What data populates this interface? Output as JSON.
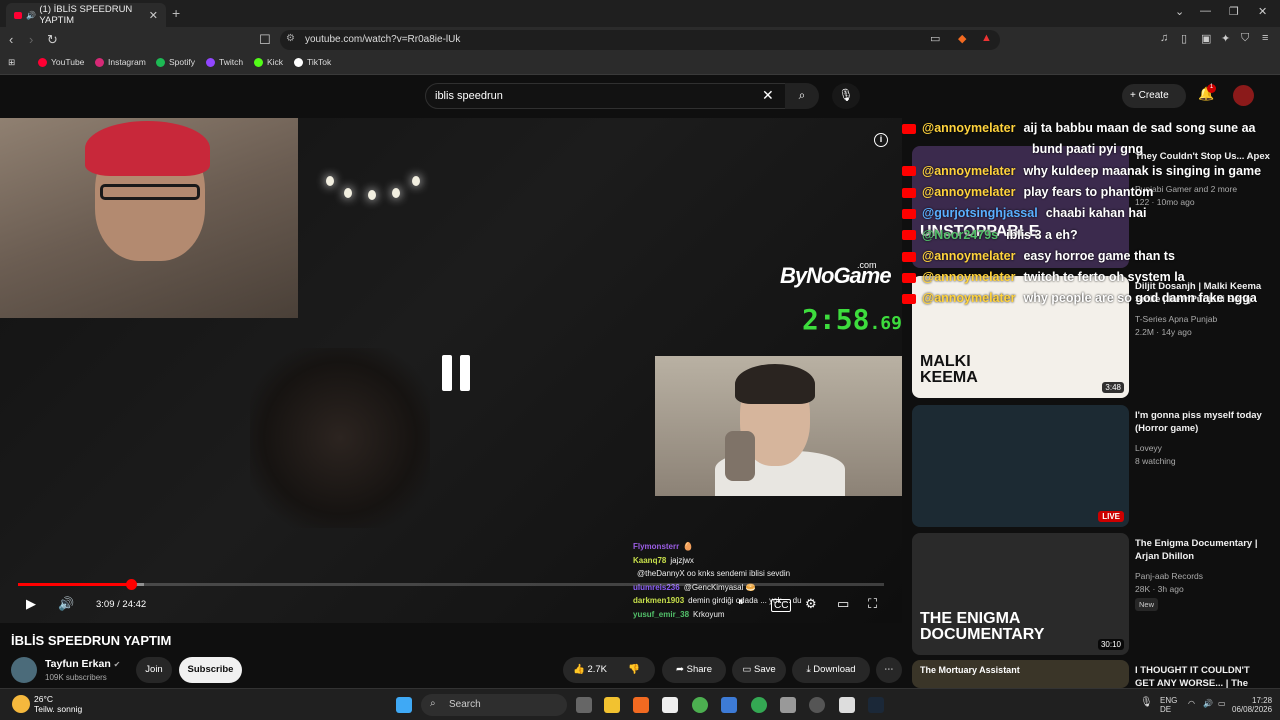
{
  "browser": {
    "tab_title": "(1) İBLİS SPEEDRUN YAPTIM",
    "url": "youtube.com/watch?v=Rr0a8ie-lUk",
    "bookmarks": [
      {
        "label": "YouTube",
        "color": "#ff0033"
      },
      {
        "label": "Instagram",
        "color": "#d62976"
      },
      {
        "label": "Spotify",
        "color": "#1db954"
      },
      {
        "label": "Twitch",
        "color": "#9146ff"
      },
      {
        "label": "Kick",
        "color": "#53fc18"
      },
      {
        "label": "TikTok",
        "color": "#ffffff"
      }
    ]
  },
  "youtube": {
    "search_value": "iblis speedrun",
    "create_label": "Create",
    "notification_count": "1"
  },
  "player": {
    "brand": "ByNoGame",
    "brand_sup": ".com",
    "timer_main": "2:58",
    "timer_ms": ".69",
    "current_time": "3:09 / 24:42",
    "progress": 0.13,
    "buffered": 0.145,
    "twitch_chat": [
      {
        "user": "Flymonsterr",
        "color": "#9b5de5",
        "msg": "🥚"
      },
      {
        "user": "Kaanq78",
        "color": "#c8e04b",
        "msg": "jajzjwx"
      },
      {
        "user": "",
        "color": "#9b5de5",
        "msg": "@theDannyX oo knks sendemi iblisi sevdin"
      },
      {
        "user": "ulumreis236",
        "color": "#8a5cf5",
        "msg": "@GencKimyasal 🥯"
      },
      {
        "user": "darkmen1903",
        "color": "#c8e04b",
        "msg": "demin girdiği odada ... yok ... du"
      },
      {
        "user": "yusuf_emir_38",
        "color": "#52c06a",
        "msg": "Krkoyum"
      }
    ]
  },
  "chat_overlay": [
    {
      "name": "@annoymelater",
      "text": "aij ta babbu maan de sad song sune aa",
      "color": "#ffd33d"
    },
    {
      "name": "",
      "text": "bund paati pyi gng",
      "color": "#ffd33d"
    },
    {
      "name": "@annoymelater",
      "text": "why kuldeep maanak is singing in game",
      "color": "#ffd33d"
    },
    {
      "name": "@annoymelater",
      "text": "play fears to phantom",
      "color": "#ffd33d"
    },
    {
      "name": "@gurjotsinghjassal",
      "text": "chaabi kahan hai",
      "color": "#5ab0ff"
    },
    {
      "name": "@Noor2479s",
      "text": "iblis 3 a eh?",
      "color": "#52c06a"
    },
    {
      "name": "@annoymelater",
      "text": "easy horroe game than ts",
      "color": "#ffd33d"
    },
    {
      "name": "@annoymelater",
      "text": "twitch te ferto oh system la",
      "color": "#ffd33d"
    },
    {
      "name": "@annoymelater",
      "text": "why people are so god damn fake ngga",
      "color": "#ffd33d"
    }
  ],
  "recommendations": [
    {
      "title": "They Couldn't Stop Us... Apex",
      "channel": "Punjabi Gamer and 2 more",
      "meta": "122 · 10mo ago",
      "duration": "",
      "thumb_color": "#3b2a4d",
      "thumb_text": "UNSTOPPABLE"
    },
    {
      "title": "Diljit Dosanjh | Malki Keema Smile | New Punjabi Song",
      "channel": "T-Series Apna Punjab",
      "meta": "2.2M · 14y ago",
      "duration": "3:48",
      "thumb_color": "#f3f0ea",
      "thumb_text": "MALKI KEEMA"
    },
    {
      "title": "I'm gonna piss myself today (Horror game)",
      "channel": "Loveyy",
      "meta": "8 watching",
      "duration": "LIVE",
      "thumb_color": "#1c2a33",
      "thumb_text": ""
    },
    {
      "title": "The Enigma Documentary | Arjan Dhillon",
      "channel": "Panj-aab Records",
      "meta": "28K · 3h ago",
      "duration": "30:10",
      "thumb_color": "#2a2a2a",
      "thumb_text": "THE ENIGMA DOCUMENTARY",
      "badge": "New"
    },
    {
      "title": "I THOUGHT IT COULDN'T GET ANY WORSE... | The Mortuary",
      "channel": "",
      "meta": "",
      "duration": "",
      "thumb_color": "#3a3528",
      "thumb_text": "The Mortuary Assistant"
    }
  ],
  "video": {
    "title": "İBLİS SPEEDRUN YAPTIM",
    "channel": "Tayfun Erkan",
    "subscribers": "109K subscribers",
    "join_label": "Join",
    "subscribe_label": "Subscribe",
    "likes": "2.7K",
    "share_label": "Share",
    "save_label": "Save",
    "download_label": "Download"
  },
  "taskbar": {
    "temperature": "26°C",
    "weather": "Teilw. sonnig",
    "search_label": "Search",
    "lang": "ENG",
    "region": "DE",
    "time": "17:28",
    "date": "06/08/2026"
  }
}
